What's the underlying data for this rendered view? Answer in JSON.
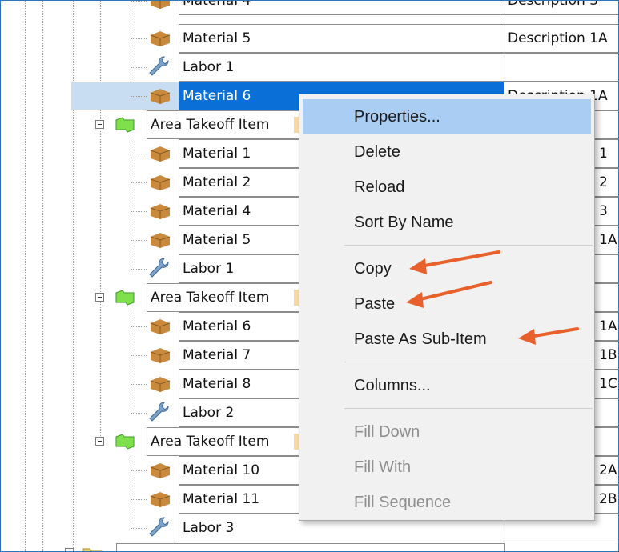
{
  "tree": {
    "rows": [
      {
        "label": "Material 4",
        "desc": "Description 3",
        "icon": "material-box-icon"
      },
      {
        "label": "Material 5",
        "desc": "Description 1A",
        "icon": "material-box-icon"
      },
      {
        "label": "Labor 1",
        "desc": "",
        "icon": "labor-wrench-icon"
      },
      {
        "label": "Material 6",
        "desc": "Description 1A",
        "icon": "material-box-icon",
        "selected": true
      },
      {
        "label": "Area Takeoff Item",
        "desc": "",
        "icon": "area-takeoff-icon"
      },
      {
        "label": "Material 1",
        "desc": "1",
        "icon": "material-box-icon"
      },
      {
        "label": "Material 2",
        "desc": "2",
        "icon": "material-box-icon"
      },
      {
        "label": "Material 4",
        "desc": "3",
        "icon": "material-box-icon"
      },
      {
        "label": "Material 5",
        "desc": "1A",
        "icon": "material-box-icon"
      },
      {
        "label": "Labor 1",
        "desc": "",
        "icon": "labor-wrench-icon"
      },
      {
        "label": "Area Takeoff Item",
        "desc": "",
        "icon": "area-takeoff-icon"
      },
      {
        "label": "Material 6",
        "desc": "1A",
        "icon": "material-box-icon"
      },
      {
        "label": "Material 7",
        "desc": "1B",
        "icon": "material-box-icon"
      },
      {
        "label": "Material 8",
        "desc": "1C",
        "icon": "material-box-icon"
      },
      {
        "label": "Labor 2",
        "desc": "",
        "icon": "labor-wrench-icon"
      },
      {
        "label": "Area Takeoff Item",
        "desc": "",
        "icon": "area-takeoff-icon"
      },
      {
        "label": "Material 10",
        "desc": "2A",
        "icon": "material-box-icon"
      },
      {
        "label": "Material 11",
        "desc": "2B",
        "icon": "material-box-icon"
      },
      {
        "label": "Labor 3",
        "desc": "",
        "icon": "labor-wrench-icon"
      }
    ]
  },
  "context_menu": {
    "properties": "Properties...",
    "delete": "Delete",
    "reload": "Reload",
    "sort_by_name": "Sort By Name",
    "copy": "Copy",
    "paste": "Paste",
    "paste_as_sub_item": "Paste As Sub-Item",
    "columns": "Columns...",
    "fill_down": "Fill Down",
    "fill_with": "Fill With",
    "fill_sequence": "Fill Sequence"
  },
  "colors": {
    "selection": "#0a6fd6",
    "menu_hover": "#a9cdf3",
    "arrow": "#e8612c",
    "frame_border": "#2e75b6"
  }
}
